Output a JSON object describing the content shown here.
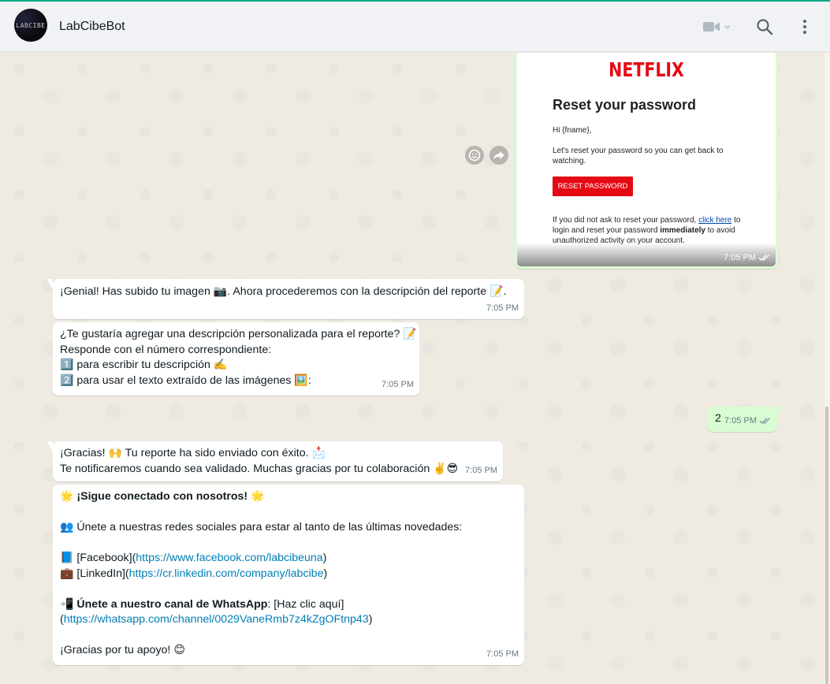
{
  "header": {
    "contact_name": "LabCibeBot",
    "avatar_text": "LABCIBE",
    "icons": [
      "video-call-icon",
      "chevron-down-icon",
      "search-icon",
      "menu-icon"
    ]
  },
  "image_message": {
    "email": {
      "logo": "NETFLIX",
      "title": "Reset your password",
      "greeting": "Hi {fname},",
      "body": "Let's reset your password so you can get back to watching.",
      "button": "RESET PASSWORD",
      "footer_pre": "If you did not ask to reset your password, ",
      "footer_link": "click here",
      "footer_mid": " to login and reset your password ",
      "footer_bold": "immediately",
      "footer_post": " to avoid unauthorized activity on your account."
    },
    "time": "7:05 PM",
    "controls": [
      "react-emoji-icon",
      "forward-icon"
    ]
  },
  "messages": {
    "m1": {
      "text_a": "¡Genial! Has subido tu imagen ",
      "emoji_a": "📷",
      "text_b": ". Ahora procederemos con la descripción del reporte ",
      "emoji_b": "📝",
      "text_c": ".",
      "time": "7:05 PM"
    },
    "m2": {
      "line1": "¿Te gustaría agregar una descripción personalizada para el reporte? ",
      "line1_emoji": "📝",
      "line2": "Responde con el número correspondiente:",
      "opt1_num": "1️⃣",
      "opt1": " para escribir tu descripción ",
      "opt1_emoji": "✍️",
      "opt2_num": "2️⃣",
      "opt2": " para usar el texto extraído de las imágenes ",
      "opt2_emoji": "🖼️",
      "opt2_end": ":",
      "time": "7:05 PM"
    },
    "m3": {
      "text": "2",
      "time": "7:05 PM"
    },
    "m4": {
      "line1": "¡Gracias! ",
      "line1_emoji": "🙌",
      "line1_b": " Tu reporte ha sido enviado con éxito. ",
      "line1_emoji2": "📩",
      "line2": "Te notificaremos cuando sea validado. Muchas gracias por tu colaboración ",
      "line2_emoji": "✌️😎",
      "time": "7:05 PM"
    },
    "m5": {
      "star": "🌟",
      "title": "¡Sigue conectado con nosotros!",
      "people_emoji": "👥",
      "intro": " Únete a nuestras redes sociales para estar al tanto de las últimas novedades:",
      "fb_emoji": "📘",
      "fb_label": " [Facebook](",
      "fb_url": "https://www.facebook.com/labcibeuna",
      "fb_close": ")",
      "li_emoji": "💼",
      "li_label": " [LinkedIn](",
      "li_url": "https://cr.linkedin.com/company/labcibe",
      "li_close": ")",
      "wa_emoji": "📲",
      "wa_bold": "Únete a nuestro canal de WhatsApp",
      "wa_text": ": [Haz clic aquí]",
      "wa_open": "(",
      "wa_url": "https://whatsapp.com/channel/0029VaneRmb7z4kZgOFtnp43",
      "wa_close": ")",
      "thanks": "¡Gracias por tu apoyo! ",
      "thanks_emoji": "😊",
      "time": "7:05 PM"
    }
  }
}
